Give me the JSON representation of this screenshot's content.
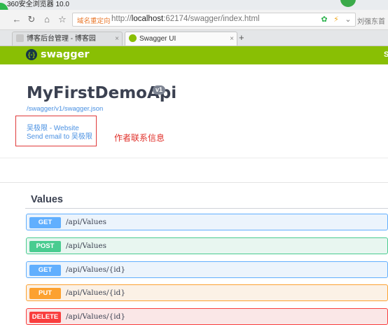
{
  "window": {
    "title": "360安全浏览器 10.0"
  },
  "toolbar": {
    "back_icon": "arrow-left-icon",
    "refresh_icon": "refresh-icon",
    "home_icon": "home-icon",
    "bookmark_icon": "star-icon",
    "redirect_tag": "域名重定向",
    "url_prefix": "http://",
    "url_host": "localhost",
    "url_rest": ":62174/swagger/index.html",
    "user_name": "刘强东首"
  },
  "tabs": [
    {
      "label": "博客后台管理 - 博客园",
      "icon": "cnblogs-icon",
      "active": false
    },
    {
      "label": "Swagger UI",
      "icon": "swagger-icon",
      "active": true
    }
  ],
  "new_tab_label": "+",
  "swagger": {
    "brand": "swagger",
    "brand_edge": "S",
    "title": "MyFirstDemoApi",
    "version": "v1",
    "spec_url": "/swagger/v1/swagger.json",
    "contact_website": "吴极限 - Website",
    "contact_email": "Send email to 吴极限"
  },
  "annotation": "作者联系信息",
  "section": {
    "title": "Values",
    "operations": [
      {
        "method": "GET",
        "path": "/api/Values"
      },
      {
        "method": "POST",
        "path": "/api/Values"
      },
      {
        "method": "GET",
        "path": "/api/Values/{id}"
      },
      {
        "method": "PUT",
        "path": "/api/Values/{id}"
      },
      {
        "method": "DELETE",
        "path": "/api/Values/{id}"
      }
    ]
  },
  "colors": {
    "swagger_green": "#89bf04",
    "get": "#61affe",
    "post": "#49cc90",
    "put": "#fca130",
    "delete": "#f93e3e",
    "annotation_red": "#e0302a"
  }
}
